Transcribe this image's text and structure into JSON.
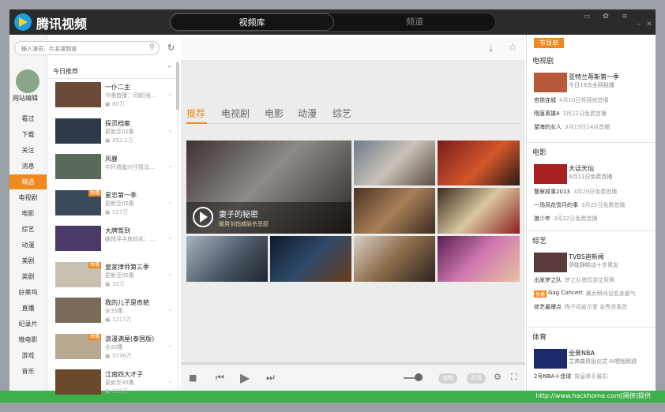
{
  "app": {
    "title": "腾讯视频"
  },
  "top_tabs": [
    {
      "label": "视频库"
    },
    {
      "label": "频道"
    }
  ],
  "window_controls": [
    "restore-icon",
    "skin-icon",
    "menu-icon",
    "minimize-icon",
    "maximize-icon",
    "close-icon"
  ],
  "search": {
    "placeholder": "输入演员、片名或频道"
  },
  "user": {
    "label": "网站编辑"
  },
  "nav": {
    "items": [
      "看过",
      "下载",
      "关注",
      "消息",
      "精选",
      "电视剧",
      "电影",
      "综艺",
      "动漫",
      "美剧",
      "英剧",
      "好莱坞",
      "直播",
      "纪录片",
      "微电影",
      "游戏",
      "音乐"
    ],
    "active": "精选"
  },
  "list": {
    "header": "今日推荐",
    "items": [
      {
        "title": "一仆二主",
        "sub": "今晚首播：闫妮|张…",
        "views": "80万",
        "badge": ""
      },
      {
        "title": "探灵档案",
        "sub": "更新至02集",
        "views": "452.1万",
        "badge": ""
      },
      {
        "title": "风暴",
        "sub": "中环墙脂兴仔情法…",
        "views": "",
        "badge": ""
      },
      {
        "title": "星恋第一季",
        "sub": "更新至05集",
        "views": "527万",
        "badge": "独播"
      },
      {
        "title": "大牌驾到",
        "sub": "脑残评中放纹花：…",
        "views": "",
        "badge": ""
      },
      {
        "title": "皇家律师第三季",
        "sub": "更新至05集",
        "views": "32万",
        "badge": "独播"
      },
      {
        "title": "我的儿子是奇葩",
        "sub": "全35集",
        "views": "1217万",
        "badge": ""
      },
      {
        "title": "浪漫满屋(泰国版)",
        "sub": "全20集",
        "views": "3736万",
        "badge": "独播"
      },
      {
        "title": "江南四大才子",
        "sub": "更新至35集",
        "views": "120万",
        "badge": ""
      }
    ]
  },
  "center": {
    "toolbar_icons": [
      "download-icon",
      "star-icon"
    ],
    "category_tabs": [
      "推荐",
      "电视剧",
      "电影",
      "动漫",
      "综艺"
    ],
    "active_category": "推荐",
    "hero": {
      "title": "妻子的秘密",
      "subtitle": "暖男剑指威胁杀恶厨"
    },
    "player": {
      "quality_label": "流畅",
      "quality2_label": "高清"
    }
  },
  "right": {
    "badge": "节目单",
    "sections": [
      {
        "title": "电视剧",
        "feature": {
          "title": "亚特兰蒂斯第一季",
          "sub": "今日19点全网独播"
        },
        "lines": [
          {
            "name": "宫锁连城",
            "time": "4月10日将网络首播"
          },
          {
            "name": "隋唐英雄4",
            "time": "3月22日免费首播"
          },
          {
            "name": "望海的女人",
            "time": "3月19日24点首播"
          }
        ]
      },
      {
        "title": "电影",
        "feature": {
          "title": "大话天仙",
          "sub": "4月11日免费首播"
        },
        "lines": [
          {
            "name": "警察故事2013",
            "time": "3月29日免费首播"
          },
          {
            "name": "一场风花雪月的事",
            "time": "3月25日免费首播"
          },
          {
            "name": "狼少年",
            "time": "3月22日免费首播"
          }
        ]
      },
      {
        "title": "综艺",
        "feature": {
          "title": "TVBS迪新闻",
          "sub": "伊能静韩谈十岁男友"
        },
        "lines": [
          {
            "name": "出发梦之队",
            "time": "梦之队借侃游沈竞赛"
          },
          {
            "tag": "独播",
            "name": "Gag Concert",
            "time": "翼女瞬间设变身霸气"
          },
          {
            "name": "综艺最爆点",
            "time": "陶子花疫示爱 金秀贤素首"
          }
        ]
      },
      {
        "title": "体育",
        "feature": {
          "title": "全景NBA",
          "sub": "艾弗森退役仪式 AI哽咽致辞"
        },
        "lines": [
          {
            "name": "2号NBA十佳球",
            "time": "詹皇单手暴扣"
          }
        ]
      }
    ]
  },
  "footer": {
    "url": "http://www.hackhome.com[网侠]提供"
  },
  "colors": {
    "accent": "#f08a1e",
    "titlebar": "#2b2b2b",
    "status": "#3cb04a"
  }
}
